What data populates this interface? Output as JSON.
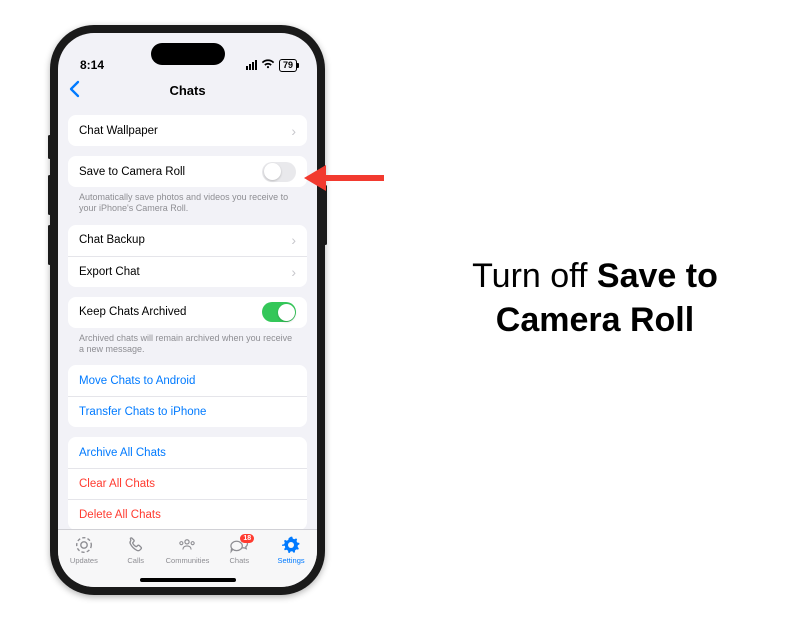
{
  "status": {
    "time": "8:14",
    "battery": "79"
  },
  "header": {
    "title": "Chats"
  },
  "groups": {
    "wallpaper": {
      "label": "Chat Wallpaper"
    },
    "saveRoll": {
      "label": "Save to Camera Roll",
      "footer": "Automatically save photos and videos you receive to your iPhone's Camera Roll."
    },
    "backup": {
      "label": "Chat Backup"
    },
    "export": {
      "label": "Export Chat"
    },
    "archive": {
      "label": "Keep Chats Archived",
      "footer": "Archived chats will remain archived when you receive a new message."
    },
    "moveAndroid": {
      "label": "Move Chats to Android"
    },
    "transferIphone": {
      "label": "Transfer Chats to iPhone"
    },
    "archiveAll": {
      "label": "Archive All Chats"
    },
    "clearAll": {
      "label": "Clear All Chats"
    },
    "deleteAll": {
      "label": "Delete All Chats"
    }
  },
  "tabs": {
    "updates": "Updates",
    "calls": "Calls",
    "communities": "Communities",
    "chats": "Chats",
    "settings": "Settings",
    "chatsBadge": "18"
  },
  "annotation": {
    "prefix": "Turn off ",
    "bold": "Save to Camera Roll"
  }
}
